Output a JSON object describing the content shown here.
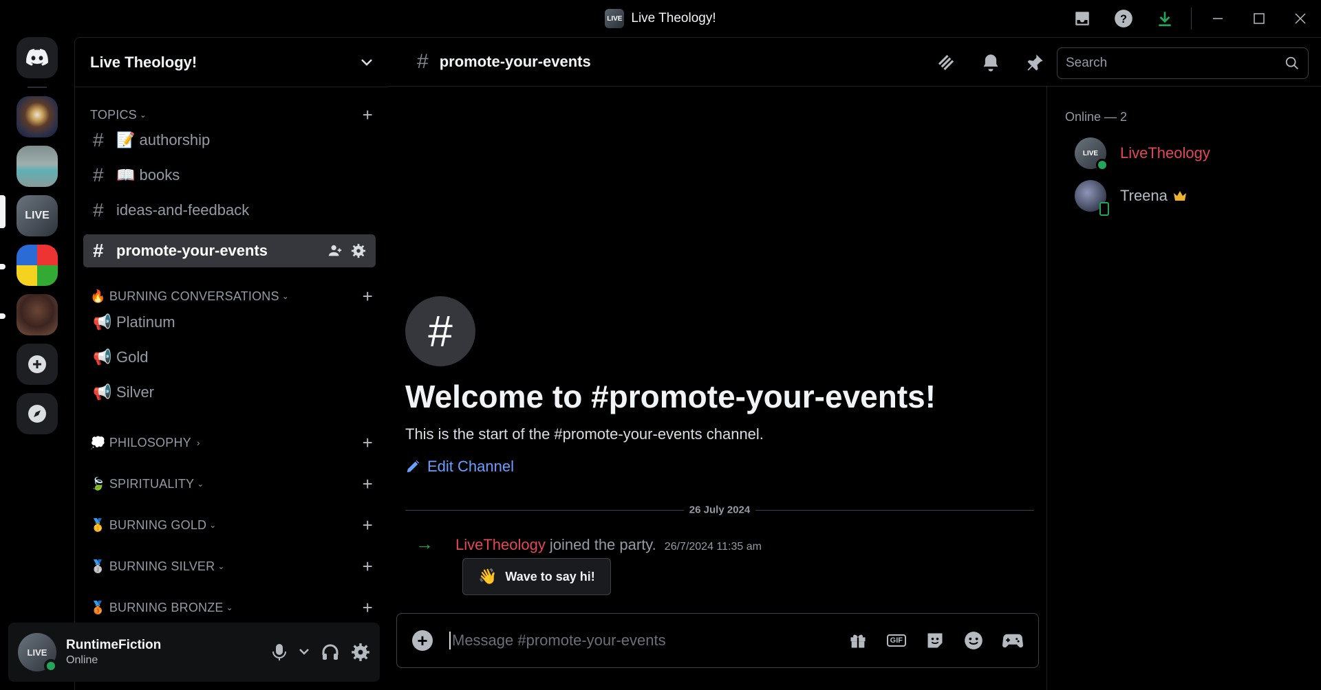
{
  "window": {
    "title": "Live Theology!",
    "logo_text": "LIVE"
  },
  "servers": [
    {
      "name": "Discord home"
    },
    {
      "name": "Spiral server"
    },
    {
      "name": "Beach server"
    },
    {
      "name": "Live Theology!",
      "selected": true
    },
    {
      "name": "Cube server"
    },
    {
      "name": "Portrait server"
    }
  ],
  "sidebar": {
    "server_name": "Live Theology!",
    "categories": [
      {
        "label": "TOPICS",
        "expanded": true
      },
      {
        "label": "🔥 BURNING CONVERSATIONS",
        "expanded": true
      },
      {
        "label": "💭 PHILOSOPHY",
        "expanded": false
      },
      {
        "label": "🍃 SPIRITUALITY",
        "expanded": true
      },
      {
        "label": "🥇 BURNING GOLD",
        "expanded": true
      },
      {
        "label": "🥈 BURNING SILVER",
        "expanded": true
      },
      {
        "label": "🥉 BURNING BRONZE",
        "expanded": true
      }
    ],
    "text_channels": [
      {
        "name": "📝 authorship"
      },
      {
        "name": "📖 books"
      },
      {
        "name": "ideas-and-feedback"
      },
      {
        "name": "promote-your-events",
        "active": true
      }
    ],
    "stage_channels": [
      {
        "name": "Platinum"
      },
      {
        "name": "Gold"
      },
      {
        "name": "Silver"
      }
    ]
  },
  "user_panel": {
    "username": "RuntimeFiction",
    "status": "Online",
    "avatar_text": "LIVE"
  },
  "chat_header": {
    "channel": "promote-your-events",
    "search_placeholder": "Search"
  },
  "welcome": {
    "title": "Welcome to #promote-your-events!",
    "subtitle": "This is the start of the #promote-your-events channel.",
    "edit_label": "Edit Channel"
  },
  "date_divider": "26 July 2024",
  "system_message": {
    "user": "LiveTheology",
    "text": "joined the party.",
    "timestamp": "26/7/2024 11:35 am",
    "wave_label": "Wave to say hi!"
  },
  "composer": {
    "placeholder": "Message #promote-your-events",
    "gif_label": "GIF"
  },
  "members": {
    "header": "Online — 2",
    "list": [
      {
        "name": "LiveTheology",
        "color": "#e3475a",
        "avatar_text": "LIVE"
      },
      {
        "name": "Treena",
        "color": "#b5bac1",
        "badge": "crown"
      }
    ]
  },
  "colors": {
    "accent_link": "#6a9fff",
    "online": "#23a55a",
    "highlight_user": "#e3475a",
    "crown": "#f0b232"
  }
}
